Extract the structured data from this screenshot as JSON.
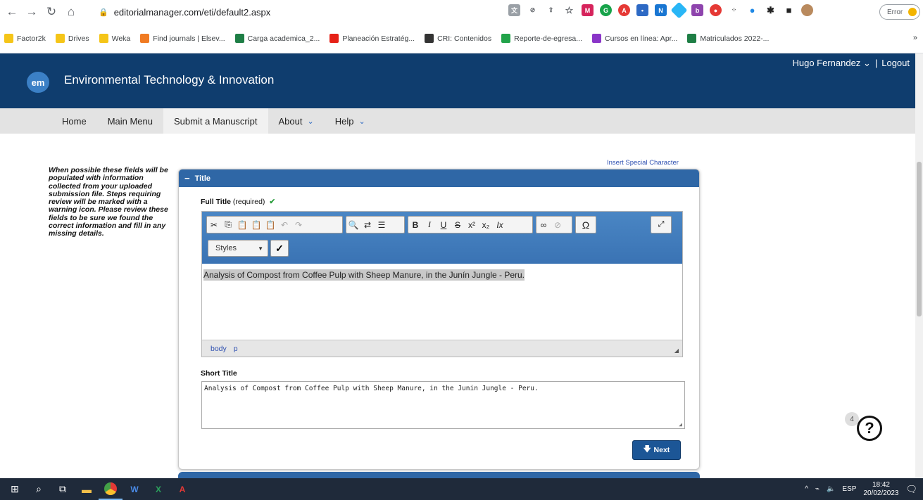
{
  "browser": {
    "url": "editorialmanager.com/eti/default2.aspx",
    "error_label": "Error"
  },
  "bookmarks": [
    {
      "label": "Factor2k",
      "color": "#f5c518"
    },
    {
      "label": "Drives",
      "color": "#f5c518"
    },
    {
      "label": "Weka",
      "color": "#f5c518"
    },
    {
      "label": "Find journals | Elsev...",
      "color": "#f07b22"
    },
    {
      "label": "Carga academica_2...",
      "color": "#1e7e45"
    },
    {
      "label": "Planeación Estratég...",
      "color": "#e62117"
    },
    {
      "label": "CRI: Contenidos",
      "color": "#333333"
    },
    {
      "label": "Reporte-de-egresa...",
      "color": "#22a34a"
    },
    {
      "label": "Cursos en línea: Apr...",
      "color": "#8a35c8"
    },
    {
      "label": "Matriculados 2022-...",
      "color": "#1e7e45"
    }
  ],
  "bookmarks_more": "»",
  "header": {
    "logo_text": "em",
    "journal_title": "Environmental Technology & Innovation",
    "user_name": "Hugo Fernandez",
    "separator": "|",
    "logout_label": "Logout"
  },
  "menu": [
    {
      "label": "Home",
      "has_chevron": false
    },
    {
      "label": "Main Menu",
      "has_chevron": false
    },
    {
      "label": "Submit a Manuscript",
      "has_chevron": false
    },
    {
      "label": "About",
      "has_chevron": true
    },
    {
      "label": "Help",
      "has_chevron": true
    }
  ],
  "sidebar_note": "When possible these fields will be populated with information collected from your uploaded submission file. Steps requiring review will be marked with a warning icon. Please review these fields to be sure we found the correct information and fill in any missing details.",
  "insert_special_label": "Insert Special Character",
  "panel": {
    "title": "Title",
    "collapse_symbol": "−",
    "full_title_label": "Full Title",
    "required_label": "(required)",
    "full_title_value": "Analysis of Compost from Coffee Pulp with Sheep Manure, in the Junín Jungle - Peru.",
    "styles_label": "Styles",
    "path_items": [
      "body",
      "p"
    ],
    "short_title_label": "Short Title",
    "short_title_value": "Analysis of Compost from Coffee Pulp with Sheep Manure, in the Junin Jungle - Peru.",
    "next_label": "Next"
  },
  "help": {
    "badge_count": "4",
    "symbol": "?"
  },
  "taskbar": {
    "language": "ESP",
    "time": "18:42",
    "date": "20/02/2023"
  }
}
